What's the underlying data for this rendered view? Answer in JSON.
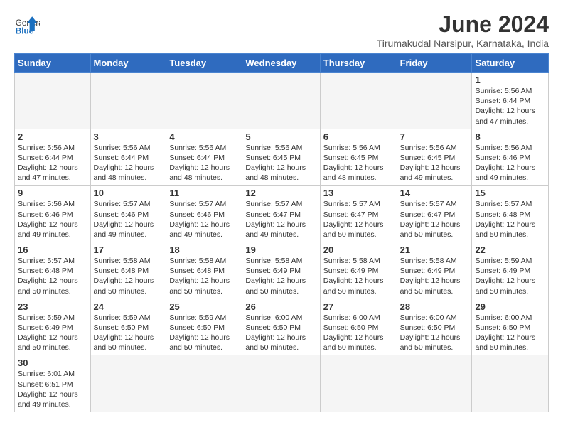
{
  "header": {
    "logo_general": "General",
    "logo_blue": "Blue",
    "month_year": "June 2024",
    "location": "Tirumakudal Narsipur, Karnataka, India"
  },
  "days_of_week": [
    "Sunday",
    "Monday",
    "Tuesday",
    "Wednesday",
    "Thursday",
    "Friday",
    "Saturday"
  ],
  "weeks": [
    [
      {
        "day": "",
        "info": ""
      },
      {
        "day": "",
        "info": ""
      },
      {
        "day": "",
        "info": ""
      },
      {
        "day": "",
        "info": ""
      },
      {
        "day": "",
        "info": ""
      },
      {
        "day": "",
        "info": ""
      },
      {
        "day": "1",
        "info": "Sunrise: 5:56 AM\nSunset: 6:44 PM\nDaylight: 12 hours and 47 minutes."
      }
    ],
    [
      {
        "day": "2",
        "info": "Sunrise: 5:56 AM\nSunset: 6:44 PM\nDaylight: 12 hours and 47 minutes."
      },
      {
        "day": "3",
        "info": "Sunrise: 5:56 AM\nSunset: 6:44 PM\nDaylight: 12 hours and 48 minutes."
      },
      {
        "day": "4",
        "info": "Sunrise: 5:56 AM\nSunset: 6:44 PM\nDaylight: 12 hours and 48 minutes."
      },
      {
        "day": "5",
        "info": "Sunrise: 5:56 AM\nSunset: 6:45 PM\nDaylight: 12 hours and 48 minutes."
      },
      {
        "day": "6",
        "info": "Sunrise: 5:56 AM\nSunset: 6:45 PM\nDaylight: 12 hours and 48 minutes."
      },
      {
        "day": "7",
        "info": "Sunrise: 5:56 AM\nSunset: 6:45 PM\nDaylight: 12 hours and 49 minutes."
      },
      {
        "day": "8",
        "info": "Sunrise: 5:56 AM\nSunset: 6:46 PM\nDaylight: 12 hours and 49 minutes."
      }
    ],
    [
      {
        "day": "9",
        "info": "Sunrise: 5:56 AM\nSunset: 6:46 PM\nDaylight: 12 hours and 49 minutes."
      },
      {
        "day": "10",
        "info": "Sunrise: 5:57 AM\nSunset: 6:46 PM\nDaylight: 12 hours and 49 minutes."
      },
      {
        "day": "11",
        "info": "Sunrise: 5:57 AM\nSunset: 6:46 PM\nDaylight: 12 hours and 49 minutes."
      },
      {
        "day": "12",
        "info": "Sunrise: 5:57 AM\nSunset: 6:47 PM\nDaylight: 12 hours and 49 minutes."
      },
      {
        "day": "13",
        "info": "Sunrise: 5:57 AM\nSunset: 6:47 PM\nDaylight: 12 hours and 50 minutes."
      },
      {
        "day": "14",
        "info": "Sunrise: 5:57 AM\nSunset: 6:47 PM\nDaylight: 12 hours and 50 minutes."
      },
      {
        "day": "15",
        "info": "Sunrise: 5:57 AM\nSunset: 6:48 PM\nDaylight: 12 hours and 50 minutes."
      }
    ],
    [
      {
        "day": "16",
        "info": "Sunrise: 5:57 AM\nSunset: 6:48 PM\nDaylight: 12 hours and 50 minutes."
      },
      {
        "day": "17",
        "info": "Sunrise: 5:58 AM\nSunset: 6:48 PM\nDaylight: 12 hours and 50 minutes."
      },
      {
        "day": "18",
        "info": "Sunrise: 5:58 AM\nSunset: 6:48 PM\nDaylight: 12 hours and 50 minutes."
      },
      {
        "day": "19",
        "info": "Sunrise: 5:58 AM\nSunset: 6:49 PM\nDaylight: 12 hours and 50 minutes."
      },
      {
        "day": "20",
        "info": "Sunrise: 5:58 AM\nSunset: 6:49 PM\nDaylight: 12 hours and 50 minutes."
      },
      {
        "day": "21",
        "info": "Sunrise: 5:58 AM\nSunset: 6:49 PM\nDaylight: 12 hours and 50 minutes."
      },
      {
        "day": "22",
        "info": "Sunrise: 5:59 AM\nSunset: 6:49 PM\nDaylight: 12 hours and 50 minutes."
      }
    ],
    [
      {
        "day": "23",
        "info": "Sunrise: 5:59 AM\nSunset: 6:49 PM\nDaylight: 12 hours and 50 minutes."
      },
      {
        "day": "24",
        "info": "Sunrise: 5:59 AM\nSunset: 6:50 PM\nDaylight: 12 hours and 50 minutes."
      },
      {
        "day": "25",
        "info": "Sunrise: 5:59 AM\nSunset: 6:50 PM\nDaylight: 12 hours and 50 minutes."
      },
      {
        "day": "26",
        "info": "Sunrise: 6:00 AM\nSunset: 6:50 PM\nDaylight: 12 hours and 50 minutes."
      },
      {
        "day": "27",
        "info": "Sunrise: 6:00 AM\nSunset: 6:50 PM\nDaylight: 12 hours and 50 minutes."
      },
      {
        "day": "28",
        "info": "Sunrise: 6:00 AM\nSunset: 6:50 PM\nDaylight: 12 hours and 50 minutes."
      },
      {
        "day": "29",
        "info": "Sunrise: 6:00 AM\nSunset: 6:50 PM\nDaylight: 12 hours and 50 minutes."
      }
    ],
    [
      {
        "day": "30",
        "info": "Sunrise: 6:01 AM\nSunset: 6:51 PM\nDaylight: 12 hours and 49 minutes."
      },
      {
        "day": "",
        "info": ""
      },
      {
        "day": "",
        "info": ""
      },
      {
        "day": "",
        "info": ""
      },
      {
        "day": "",
        "info": ""
      },
      {
        "day": "",
        "info": ""
      },
      {
        "day": "",
        "info": ""
      }
    ]
  ]
}
